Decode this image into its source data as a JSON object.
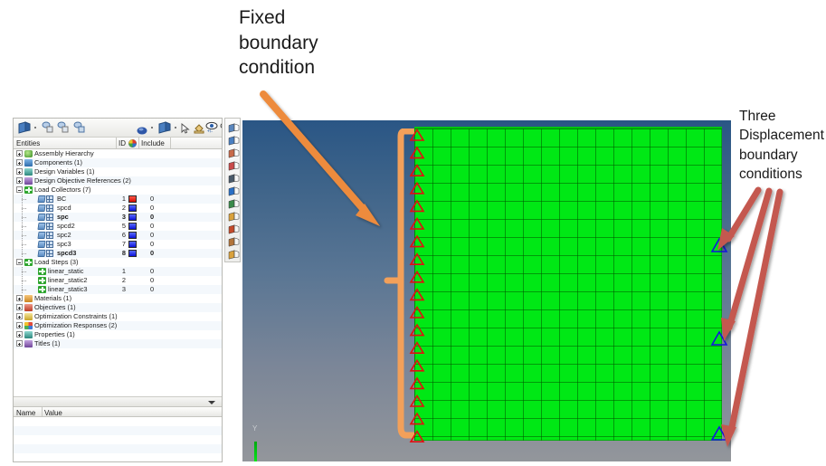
{
  "annotations": {
    "fixed": "Fixed\nboundary\ncondition",
    "three": "Three\nDisplacement\nboundary\nconditions",
    "fixed_arrow_color": "#ED8B3C",
    "bracket_color": "#F2A05A",
    "three_arrow_color": "#C4584F"
  },
  "browser": {
    "toolbar": {
      "icons": [
        "model-view-icon",
        "dropdown-arrow-icon",
        "component-collector-icon",
        "component-collector-2-icon",
        "component-collector-3-icon",
        "elements-icon",
        "dropdown-arrow-2-icon",
        "geometry-icon",
        "dropdown-arrow-3-icon",
        "select-pointer-icon",
        "paint-bucket-icon",
        "visibility-plus-minus-icon",
        "visibility-icon"
      ]
    },
    "columns": {
      "entities": "Entities",
      "id": "ID",
      "color": "color-wheel-icon",
      "include": "Include"
    },
    "tree": [
      {
        "label": "Assembly Hierarchy",
        "depth": 0,
        "id": "",
        "include": "",
        "expander": "closed",
        "icon": "assembly-icon",
        "bold": false
      },
      {
        "label": "Components (1)",
        "depth": 0,
        "id": "",
        "include": "",
        "expander": "closed",
        "icon": "components-icon",
        "bold": false
      },
      {
        "label": "Design Variables (1)",
        "depth": 0,
        "id": "",
        "include": "",
        "expander": "closed",
        "icon": "design-variables-icon",
        "bold": false
      },
      {
        "label": "Design Objective References (2)",
        "depth": 0,
        "id": "",
        "include": "",
        "expander": "closed",
        "icon": "design-objective-icon",
        "bold": false
      },
      {
        "label": "Load Collectors (7)",
        "depth": 0,
        "id": "",
        "include": "",
        "expander": "open",
        "icon": "load-collectors-icon",
        "bold": false
      },
      {
        "label": "BC",
        "depth": 1,
        "id": "1",
        "include": "0",
        "expander": "none",
        "icon": "load-collector-icon",
        "swatch": "red",
        "bold": false
      },
      {
        "label": "spcd",
        "depth": 1,
        "id": "2",
        "include": "0",
        "expander": "none",
        "icon": "load-collector-icon",
        "swatch": "blue",
        "bold": false
      },
      {
        "label": "spc",
        "depth": 1,
        "id": "3",
        "include": "0",
        "expander": "none",
        "icon": "load-collector-icon",
        "swatch": "blue",
        "bold": true
      },
      {
        "label": "spcd2",
        "depth": 1,
        "id": "5",
        "include": "0",
        "expander": "none",
        "icon": "load-collector-icon",
        "swatch": "blue",
        "bold": false
      },
      {
        "label": "spc2",
        "depth": 1,
        "id": "6",
        "include": "0",
        "expander": "none",
        "icon": "load-collector-icon",
        "swatch": "blue",
        "bold": false
      },
      {
        "label": "spc3",
        "depth": 1,
        "id": "7",
        "include": "0",
        "expander": "none",
        "icon": "load-collector-icon",
        "swatch": "blue",
        "bold": false
      },
      {
        "label": "spcd3",
        "depth": 1,
        "id": "8",
        "include": "0",
        "expander": "none",
        "icon": "load-collector-icon",
        "swatch": "blue",
        "bold": true
      },
      {
        "label": "Load Steps (3)",
        "depth": 0,
        "id": "",
        "include": "",
        "expander": "open",
        "icon": "load-steps-icon",
        "bold": false
      },
      {
        "label": "linear_static",
        "depth": 1,
        "id": "1",
        "include": "0",
        "expander": "none",
        "icon": "load-step-icon",
        "bold": false
      },
      {
        "label": "linear_static2",
        "depth": 1,
        "id": "2",
        "include": "0",
        "expander": "none",
        "icon": "load-step-icon",
        "bold": false
      },
      {
        "label": "linear_static3",
        "depth": 1,
        "id": "3",
        "include": "0",
        "expander": "none",
        "icon": "load-step-icon",
        "bold": false
      },
      {
        "label": "Materials (1)",
        "depth": 0,
        "id": "",
        "include": "",
        "expander": "closed",
        "icon": "materials-icon",
        "bold": false
      },
      {
        "label": "Objectives (1)",
        "depth": 0,
        "id": "",
        "include": "",
        "expander": "closed",
        "icon": "objectives-icon",
        "bold": false
      },
      {
        "label": "Optimization Constraints (1)",
        "depth": 0,
        "id": "",
        "include": "",
        "expander": "closed",
        "icon": "optimization-constraints-icon",
        "bold": false
      },
      {
        "label": "Optimization Responses (2)",
        "depth": 0,
        "id": "",
        "include": "",
        "expander": "closed",
        "icon": "optimization-responses-icon",
        "bold": false
      },
      {
        "label": "Properties (1)",
        "depth": 0,
        "id": "",
        "include": "",
        "expander": "closed",
        "icon": "properties-icon",
        "bold": false
      },
      {
        "label": "Titles (1)",
        "depth": 0,
        "id": "",
        "include": "",
        "expander": "closed",
        "icon": "titles-icon",
        "bold": false
      }
    ],
    "name_value": {
      "name_header": "Name",
      "value_header": "Value",
      "rows": []
    }
  },
  "side_strip": {
    "icons": [
      "geometry-panel-icon",
      "surfaces-panel-icon",
      "solids-panel-icon",
      "circle-panel-icon",
      "connectors-panel-icon",
      "numbers-123-icon",
      "vector-plot-icon",
      "abc-label-icon",
      "abc-measure-icon",
      "mask-panel-icon",
      "view-panel-icon"
    ]
  },
  "viewport": {
    "axis_label_y": "Y",
    "background_top": "#2A5685",
    "background_bottom": "#93969B",
    "mesh_color": "#00E815",
    "mesh_grid_color": "#005A00",
    "mesh_columns": 17,
    "mesh_rows": 17,
    "fixed_constraint_marker_color": "#E01010",
    "fixed_constraint_marker_count": 18,
    "displacement_marker_color": "#1414E0",
    "displacement_marker_count": 3
  }
}
